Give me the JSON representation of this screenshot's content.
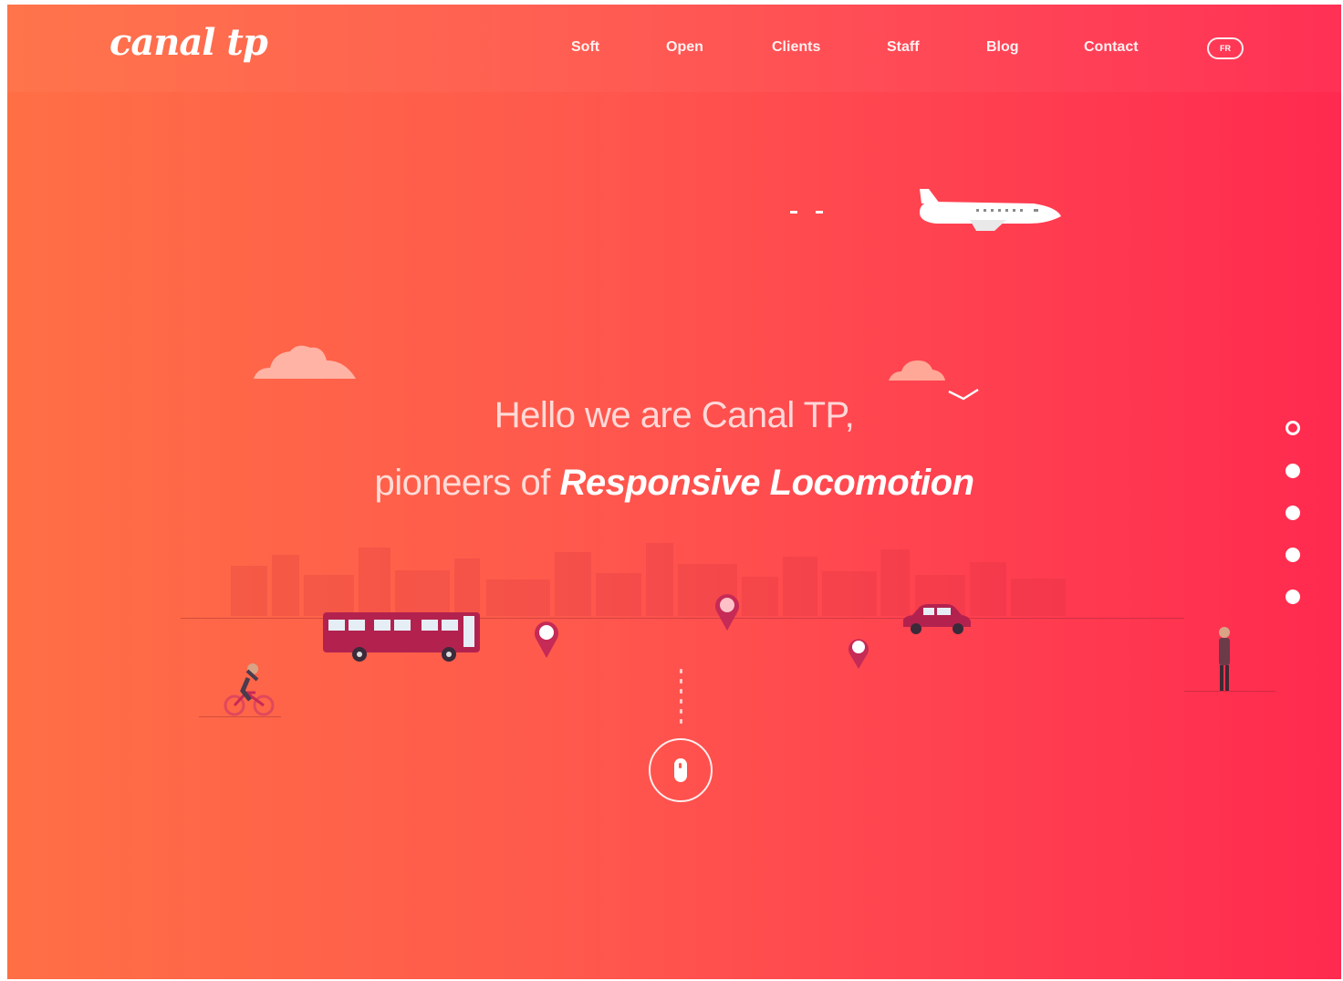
{
  "brand": {
    "logo": "canal tp"
  },
  "nav": {
    "items": [
      {
        "label": "Soft"
      },
      {
        "label": "Open"
      },
      {
        "label": "Clients"
      },
      {
        "label": "Staff"
      },
      {
        "label": "Blog"
      },
      {
        "label": "Contact"
      }
    ],
    "language": "FR"
  },
  "hero": {
    "line1": "Hello we are Canal TP,",
    "line2_prefix": "pioneers of ",
    "line2_accent": "Responsive Locomotion"
  },
  "side_nav": {
    "count": 5,
    "active_index": 0
  },
  "illustration": {
    "objects": [
      "plane-icon",
      "cloud-icon",
      "bird-icon",
      "bus-icon",
      "map-pin-icon",
      "car-icon",
      "cyclist-icon",
      "pedestrian-icon"
    ]
  },
  "colors": {
    "gradient_start": "#ff6f45",
    "gradient_end": "#ff2a4f",
    "bus": "#b3224f",
    "car": "#b3224f",
    "pin": "#c62a56"
  }
}
